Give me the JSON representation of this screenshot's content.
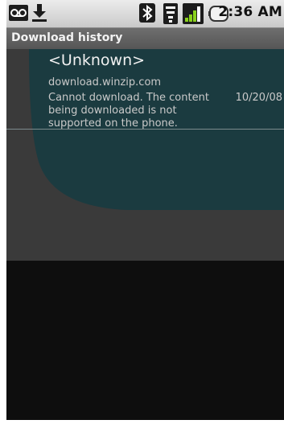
{
  "status_bar": {
    "time": "2:36 AM",
    "icons": [
      "voicemail-icon",
      "download-icon",
      "bluetooth-icon",
      "wifi-icon",
      "signal-icon",
      "battery-icon"
    ]
  },
  "header": {
    "title": "Download history"
  },
  "downloads": [
    {
      "name": "<Unknown>",
      "host": "download.winzip.com",
      "status": "Cannot download. The content being downloaded is not supported on the phone.",
      "date": "10/20/08"
    }
  ],
  "colors": {
    "wallpaper_base": "#3a3a3a",
    "wallpaper_shape": "#1b3b40",
    "title_bar": "#5f5f5f",
    "background": "#0e0e0e"
  }
}
